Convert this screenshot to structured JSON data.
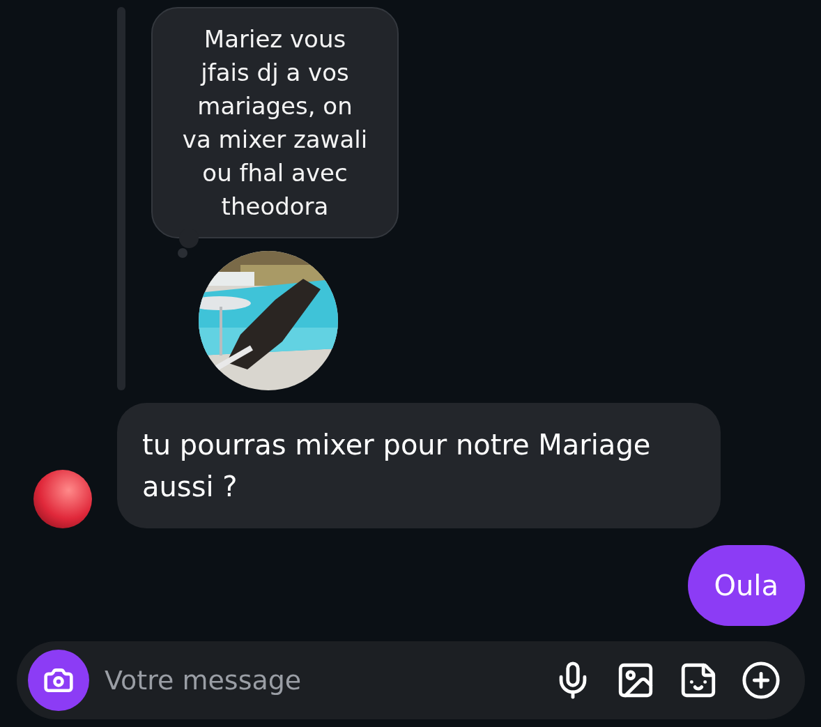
{
  "reply": {
    "note": "Mariez vous\njfais dj a vos\nmariages, on\nva mixer zawali\nou fhal avec\ntheodora"
  },
  "messages": [
    {
      "kind": "received",
      "text": "tu pourras mixer pour notre Mariage aussi ?"
    },
    {
      "kind": "sent",
      "text": "Oula"
    }
  ],
  "composer": {
    "placeholder": "Votre message"
  }
}
